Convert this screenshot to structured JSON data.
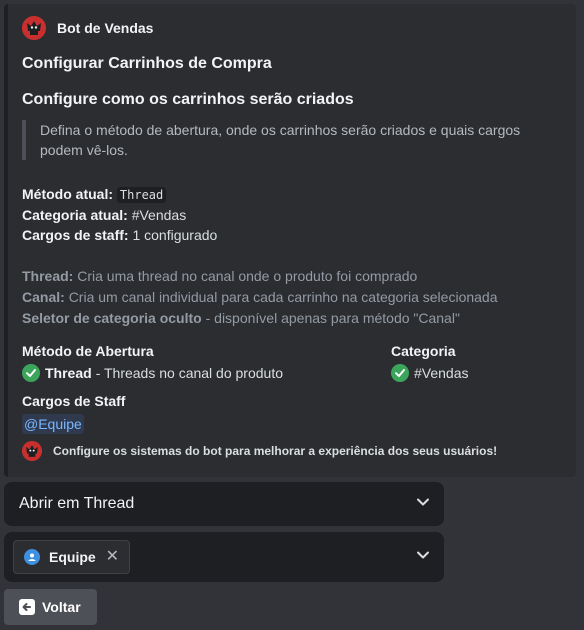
{
  "embed": {
    "author_name": "Bot de Vendas",
    "title": "Configurar Carrinhos de Compra",
    "heading": "Configure como os carrinhos serão criados",
    "quote": "Defina o método de abertura, onde os carrinhos serão criados e quais cargos podem vê-los.",
    "info": {
      "method_label": "Método atual:",
      "method_value": "Thread",
      "category_label": "Categoria atual:",
      "category_value": "#Vendas",
      "staff_label": "Cargos de staff:",
      "staff_value": "1 configurado"
    },
    "descriptions": {
      "thread_label": "Thread:",
      "thread_text": "Cria uma thread no canal onde o produto foi comprado",
      "canal_label": "Canal:",
      "canal_text": "Cria um canal individual para cada carrinho na categoria selecionada",
      "selector_label": "Seletor de categoria oculto",
      "selector_text": "- disponível apenas para método \"Canal\""
    },
    "fields": {
      "method_name": "Método de Abertura",
      "method_value_bold": "Thread",
      "method_value_rest": "- Threads no canal do produto",
      "category_name": "Categoria",
      "category_value": "#Vendas",
      "staff_name": "Cargos de Staff",
      "staff_mention": "@Equipe"
    },
    "footer_text": "Configure os sistemas do bot para melhorar a experiência dos seus usuários!"
  },
  "select_method": {
    "value": "Abrir em Thread"
  },
  "select_roles": {
    "tags": [
      {
        "label": "Equipe",
        "remove": "✕"
      }
    ]
  },
  "back_button": {
    "label": "Voltar"
  },
  "colors": {
    "background": "#313338",
    "embed": "#2b2d31",
    "check": "#3ba55c",
    "mention": "#7ab7ff",
    "avatar": "#c7302f"
  }
}
